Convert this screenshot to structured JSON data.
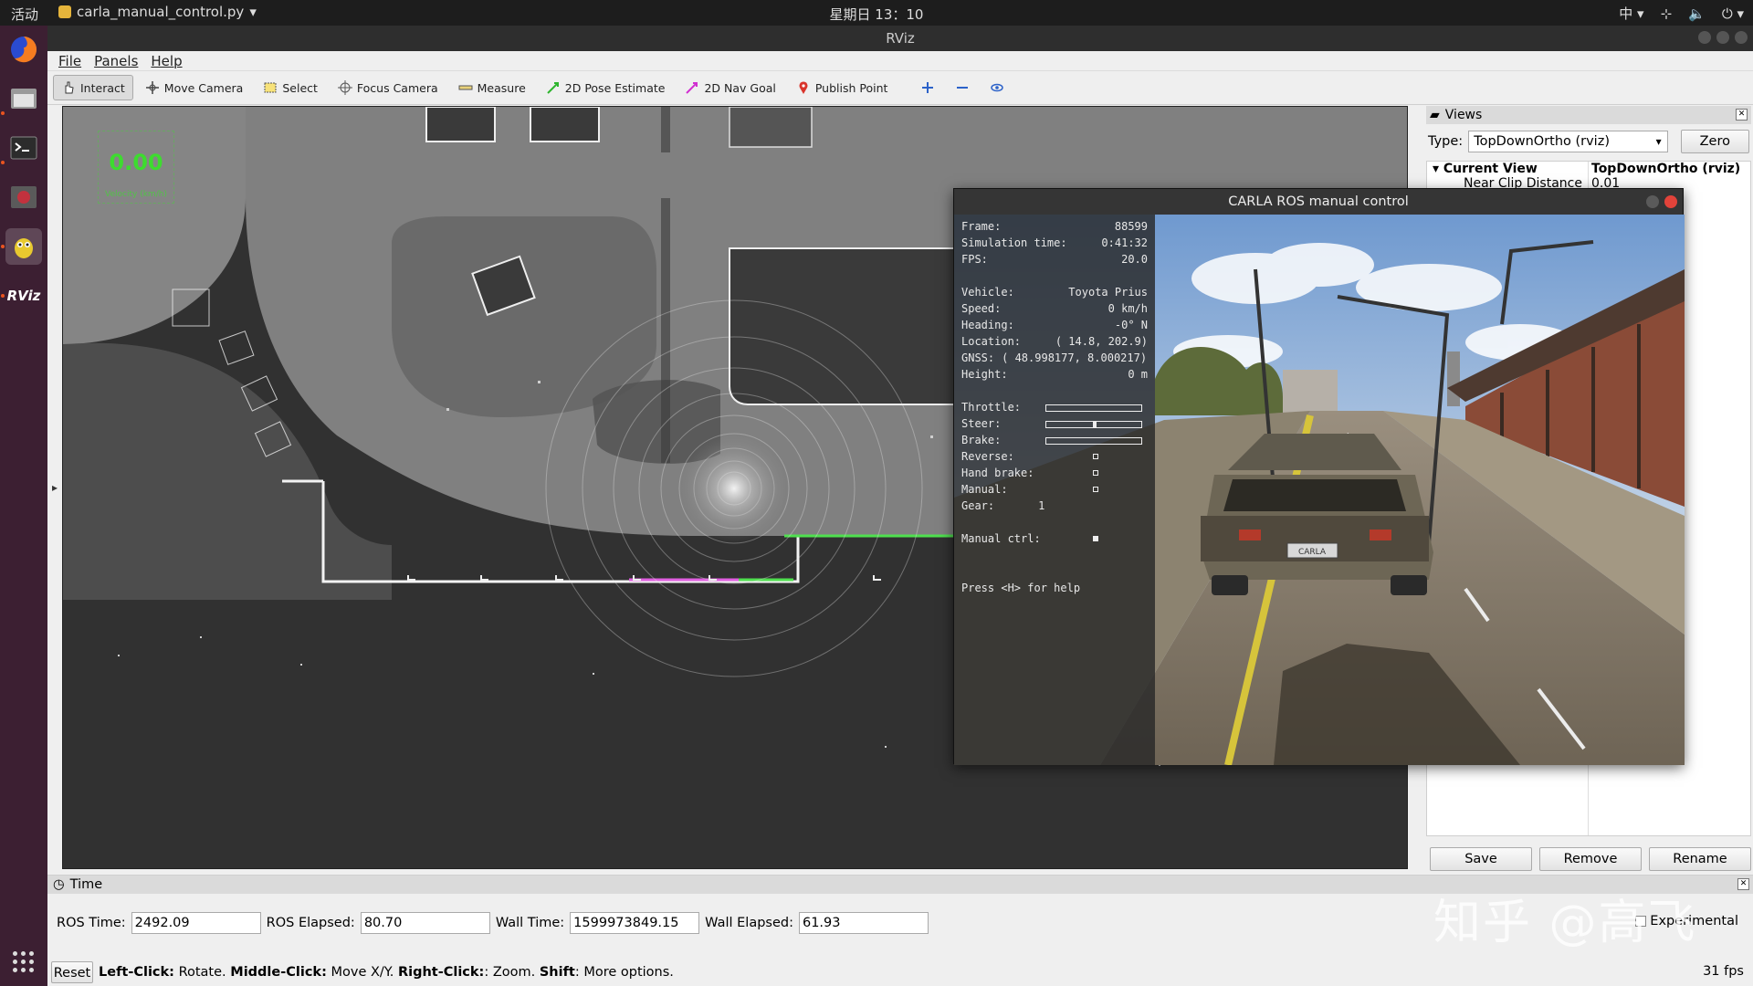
{
  "topbar": {
    "activities": "活动",
    "app_menu": "carla_manual_control.py",
    "clock": "星期日 13：10",
    "input_method": "中"
  },
  "window": {
    "title": "RViz"
  },
  "menu": {
    "file": "File",
    "panels": "Panels",
    "help": "Help"
  },
  "toolbar": {
    "interact": "Interact",
    "move_camera": "Move Camera",
    "select": "Select",
    "focus_camera": "Focus Camera",
    "measure": "Measure",
    "pose_estimate": "2D Pose Estimate",
    "nav_goal": "2D Nav Goal",
    "publish_point": "Publish Point"
  },
  "overlay": {
    "speed_value": "0.00",
    "speed_label": "Velocity (km/h)"
  },
  "views": {
    "title": "Views",
    "type_label": "Type:",
    "type_value": "TopDownOrtho (rviz)",
    "zero_label": "Zero",
    "current_view_label": "Current View",
    "current_view_value": "TopDownOrtho (rviz)",
    "near_clip_label": "Near Clip Distance",
    "near_clip_value": "0.01",
    "save_label": "Save",
    "remove_label": "Remove",
    "rename_label": "Rename"
  },
  "time": {
    "title": "Time",
    "ros_time_label": "ROS Time:",
    "ros_time_value": "2492.09",
    "ros_elapsed_label": "ROS Elapsed:",
    "ros_elapsed_value": "80.70",
    "wall_time_label": "Wall Time:",
    "wall_time_value": "1599973849.15",
    "wall_elapsed_label": "Wall Elapsed:",
    "wall_elapsed_value": "61.93",
    "experimental_label": "Experimental"
  },
  "status": {
    "reset_label": "Reset",
    "left_click": "Left-Click:",
    "left_click_desc": "Rotate.",
    "middle_click": "Middle-Click:",
    "middle_click_desc": "Move X/Y.",
    "right_click": "Right-Click:",
    "right_click_desc": ": Zoom.",
    "shift": "Shift",
    "shift_desc": ": More options.",
    "fps": "31 fps"
  },
  "carla": {
    "title": "CARLA ROS manual control",
    "hud": {
      "frame_label": "Frame:",
      "frame_value": "88599",
      "sim_time_label": "Simulation time:",
      "sim_time_value": "0:41:32",
      "fps_label": "FPS:",
      "fps_value": "20.0",
      "vehicle_label": "Vehicle:",
      "vehicle_value": "Toyota Prius",
      "speed_label": "Speed:",
      "speed_value": "0 km/h",
      "heading_label": "Heading:",
      "heading_value": "-0° N",
      "location_label": "Location:",
      "location_value": "( 14.8, 202.9)",
      "gnss_label": "GNSS:",
      "gnss_value": "( 48.998177, 8.000217)",
      "height_label": "Height:",
      "height_value": "0 m",
      "throttle_label": "Throttle:",
      "throttle_value": 0.0,
      "steer_label": "Steer:",
      "steer_value": 0.0,
      "brake_label": "Brake:",
      "brake_value": 0.0,
      "reverse_label": "Reverse:",
      "reverse_on": false,
      "handbrake_label": "Hand brake:",
      "handbrake_on": false,
      "manual_label": "Manual:",
      "manual_on": false,
      "gear_label": "Gear:",
      "gear_value": "1",
      "manual_ctrl_label": "Manual ctrl:",
      "manual_ctrl_on": true,
      "help_text": "Press <H> for help"
    },
    "plate": "CARLA"
  },
  "watermark": "知乎 @高飞",
  "colors": {
    "ubuntu_orange": "#e95420",
    "overlay_green": "#3ddc2f",
    "dock_bg": "#3c1f32"
  }
}
